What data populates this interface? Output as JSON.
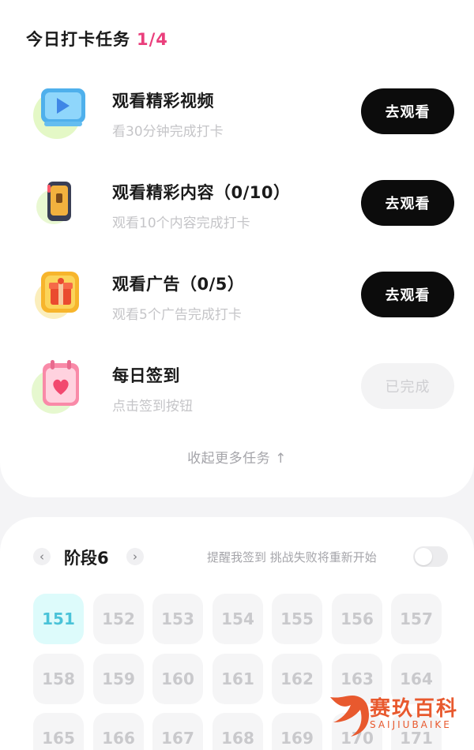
{
  "tasks_header": {
    "title": "今日打卡任务",
    "progress": "1/4"
  },
  "tasks": [
    {
      "title": "观看精彩视频",
      "subtitle": "看30分钟完成打卡",
      "button": "去观看",
      "icon": "video-play-icon"
    },
    {
      "title": "观看精彩内容（0/10）",
      "subtitle": "观看10个内容完成打卡",
      "button": "去观看",
      "icon": "phone-content-icon"
    },
    {
      "title": "观看广告（0/5）",
      "subtitle": "观看5个广告完成打卡",
      "button": "去观看",
      "icon": "gift-ad-icon"
    },
    {
      "title": "每日签到",
      "subtitle": "点击签到按钮",
      "button": "已完成",
      "icon": "calendar-heart-icon"
    }
  ],
  "collapse_label": "收起更多任务 ↑",
  "stage": {
    "prev_icon": "‹",
    "next_icon": "›",
    "label": "阶段6",
    "remind_text": "提醒我签到 挑战失败将重新开始",
    "remind_toggle_on": false
  },
  "days": {
    "active": "151",
    "rows": [
      [
        "151",
        "152",
        "153",
        "154",
        "155",
        "156",
        "157"
      ],
      [
        "158",
        "159",
        "160",
        "161",
        "162",
        "163",
        "164"
      ],
      [
        "165",
        "166",
        "167",
        "168",
        "169",
        "170",
        "171"
      ]
    ]
  },
  "watermark": {
    "title": "赛玖百科",
    "subtitle": "SAIJIUBAIKE"
  },
  "colors": {
    "accent_pink": "#ea3f7c",
    "button_dark": "#0c0c0c",
    "active_day_bg": "#ddfbfb",
    "active_day_text": "#4ac3d8",
    "watermark": "#e8592e"
  }
}
